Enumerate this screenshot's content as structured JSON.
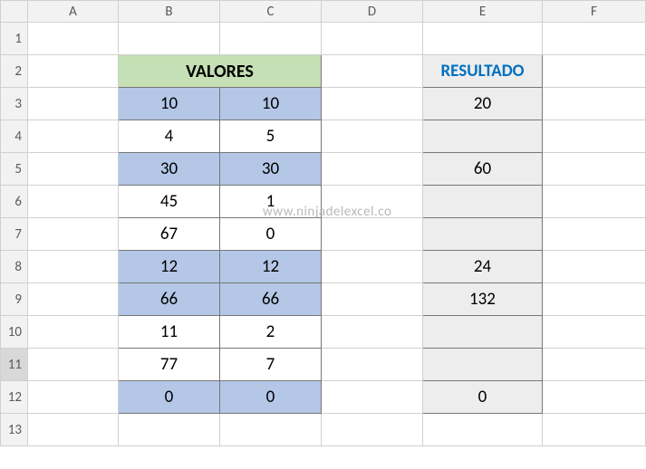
{
  "columns": [
    "A",
    "B",
    "C",
    "D",
    "E",
    "F"
  ],
  "rows": [
    "1",
    "2",
    "3",
    "4",
    "5",
    "6",
    "7",
    "8",
    "9",
    "10",
    "11",
    "12",
    "13"
  ],
  "headers": {
    "valores": "VALORES",
    "resultado": "RESULTADO"
  },
  "watermark": "www.ninjadelexcel.co",
  "active_row_index": 10,
  "data": [
    {
      "b": "10",
      "c": "10",
      "e": "20",
      "highlight": true
    },
    {
      "b": "4",
      "c": "5",
      "e": "",
      "highlight": false
    },
    {
      "b": "30",
      "c": "30",
      "e": "60",
      "highlight": true
    },
    {
      "b": "45",
      "c": "1",
      "e": "",
      "highlight": false
    },
    {
      "b": "67",
      "c": "0",
      "e": "",
      "highlight": false
    },
    {
      "b": "12",
      "c": "12",
      "e": "24",
      "highlight": true
    },
    {
      "b": "66",
      "c": "66",
      "e": "132",
      "highlight": true
    },
    {
      "b": "11",
      "c": "2",
      "e": "",
      "highlight": false
    },
    {
      "b": "77",
      "c": "7",
      "e": "",
      "highlight": false
    },
    {
      "b": "0",
      "c": "0",
      "e": "0",
      "highlight": true
    }
  ],
  "chart_data": {
    "type": "table",
    "title": "VALORES / RESULTADO",
    "columns": [
      "B",
      "C",
      "E"
    ],
    "column_labels": [
      "VALORES (col B)",
      "VALORES (col C)",
      "RESULTADO"
    ],
    "rows": [
      [
        10,
        10,
        20
      ],
      [
        4,
        5,
        null
      ],
      [
        30,
        30,
        60
      ],
      [
        45,
        1,
        null
      ],
      [
        67,
        0,
        null
      ],
      [
        12,
        12,
        24
      ],
      [
        66,
        66,
        132
      ],
      [
        11,
        2,
        null
      ],
      [
        77,
        7,
        null
      ],
      [
        0,
        0,
        0
      ]
    ],
    "note": "RESULTADO populated where col B equals col C (sum of the two); highlighted rows shaded blue."
  }
}
